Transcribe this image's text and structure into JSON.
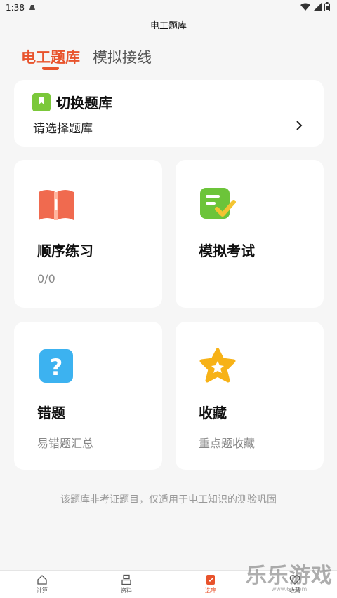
{
  "status": {
    "time": "1:38"
  },
  "app": {
    "title": "电工题库"
  },
  "tabs": [
    {
      "label": "电工题库",
      "active": true
    },
    {
      "label": "模拟接线",
      "active": false
    }
  ],
  "switch_bank": {
    "title": "切换题库",
    "subtitle": "请选择题库",
    "chevron": "›"
  },
  "cards": [
    {
      "title": "顺序练习",
      "sub": "0/0",
      "icon": "open-book-icon"
    },
    {
      "title": "模拟考试",
      "sub": "",
      "icon": "exam-check-icon"
    },
    {
      "title": "错题",
      "sub": "易错题汇总",
      "icon": "question-icon"
    },
    {
      "title": "收藏",
      "sub": "重点题收藏",
      "icon": "star-icon"
    }
  ],
  "notice": "该题库非考证题目，仅适用于电工知识的测验巩固",
  "bottom_nav": [
    {
      "label": "计算",
      "icon": "home-icon"
    },
    {
      "label": "资料",
      "icon": "document-icon"
    },
    {
      "label": "选库",
      "icon": "bank-icon",
      "active": true
    },
    {
      "label": "收藏",
      "icon": "heart-icon"
    }
  ],
  "watermark": {
    "main": "乐乐游戏",
    "sub": "www.6ll.com"
  },
  "colors": {
    "accent": "#e8532c",
    "background": "#f6f6f6"
  }
}
